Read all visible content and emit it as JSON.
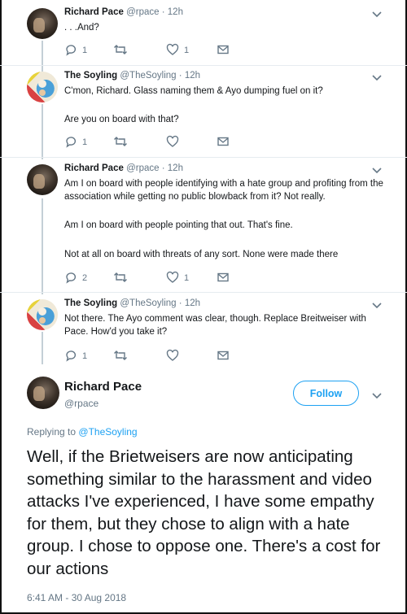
{
  "tweets": [
    {
      "name": "Richard Pace",
      "handle": "@rpace",
      "time": "12h",
      "text": ". . .And?",
      "reply_count": "1",
      "retweet_count": "",
      "like_count": "1"
    },
    {
      "name": "The Soyling",
      "handle": "@TheSoyling",
      "time": "12h",
      "text": "C'mon, Richard. Glass naming them & Ayo dumping fuel on it?",
      "text2": "Are you on board with that?",
      "reply_count": "1",
      "retweet_count": "",
      "like_count": ""
    },
    {
      "name": "Richard Pace",
      "handle": "@rpace",
      "time": "12h",
      "text": "Am I on board with people identifying with a hate group and profiting from the association while getting no public blowback from it?  Not really.",
      "text2": "Am I on board with people pointing that out.  That's fine.",
      "text3": "Not at all on board with threats of any sort.  None were made there",
      "reply_count": "2",
      "retweet_count": "",
      "like_count": "1"
    },
    {
      "name": "The Soyling",
      "handle": "@TheSoyling",
      "time": "12h",
      "text": "Not there. The Ayo comment was clear, though. Replace Breitweiser with Pace. How'd you take it?",
      "reply_count": "1",
      "retweet_count": "",
      "like_count": ""
    }
  ],
  "separator": "·",
  "main": {
    "name": "Richard Pace",
    "handle": "@rpace",
    "follow_label": "Follow",
    "replying_prefix": "Replying to",
    "replying_handle": "@TheSoyling",
    "text": "Well, if the Brietweisers are now anticipating something similar to the harassment and video attacks I've experienced, I have some empathy for them, but they chose to align with a hate group.  I chose to oppose one.  There's a cost for our actions",
    "timestamp": "6:41 AM - 30 Aug 2018"
  },
  "colors": {
    "accent": "#1da1f2",
    "muted": "#657786",
    "text": "#14171a",
    "thread_line": "#c4cfd6"
  },
  "icons": [
    "reply-icon",
    "retweet-icon",
    "heart-icon",
    "message-icon",
    "chevron-down-icon"
  ]
}
